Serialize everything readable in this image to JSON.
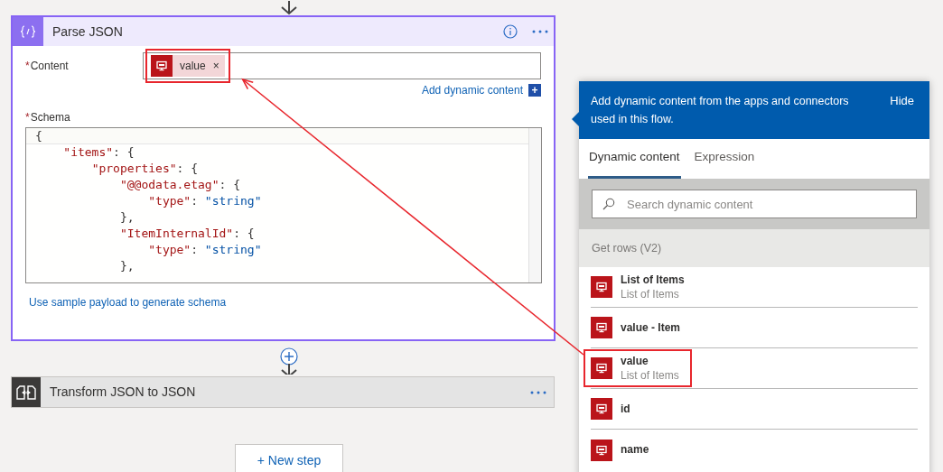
{
  "parse_json": {
    "title": "Parse JSON",
    "required_mark": "*",
    "content": {
      "label": "Content",
      "required": true,
      "token": {
        "label": "value",
        "remove": "×",
        "annotated": true
      }
    },
    "add_dynamic": {
      "label": "Add dynamic content",
      "icon": "+"
    },
    "schema": {
      "label": "Schema",
      "required": true,
      "lines": [
        "{",
        "    \"items\": {",
        "        \"properties\": {",
        "            \"@@odata.etag\": {",
        "                \"type\": \"string\"",
        "            },",
        "            \"ItemInternalId\": {",
        "                \"type\": \"string\"",
        "            },"
      ]
    },
    "sample_link": "Use sample payload to generate schema"
  },
  "transform_step": {
    "title": "Transform JSON to JSON"
  },
  "new_step": "+ New step",
  "dynamic_panel": {
    "message": "Add dynamic content from the apps and connectors used in this flow.",
    "hide": "Hide",
    "tabs": [
      {
        "label": "Dynamic content",
        "selected": true
      },
      {
        "label": "Expression",
        "selected": false
      }
    ],
    "search": {
      "placeholder": "Search dynamic content"
    },
    "group": "Get rows (V2)",
    "items": [
      {
        "title": "List of Items",
        "subtitle": "List of Items",
        "annotated": false
      },
      {
        "title": "value - Item",
        "annotated": false
      },
      {
        "title": "value",
        "subtitle": "List of Items",
        "annotated": true
      },
      {
        "title": "id",
        "annotated": false
      },
      {
        "title": "name",
        "annotated": false
      }
    ]
  }
}
